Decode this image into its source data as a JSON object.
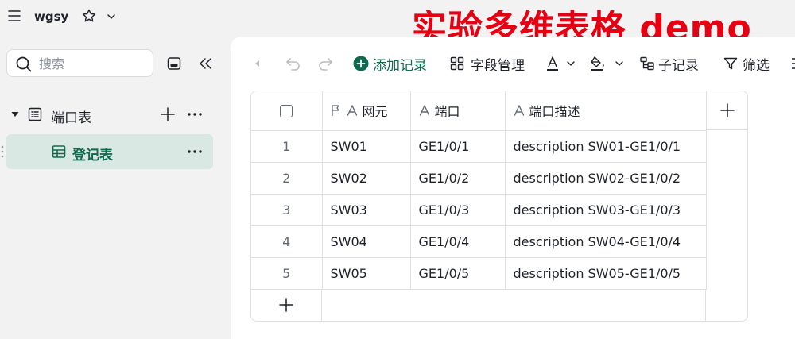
{
  "header": {
    "title": "wgsy",
    "banner": "实验多维表格 demo"
  },
  "sidebar": {
    "search": {
      "placeholder": "搜索",
      "value": ""
    },
    "items": [
      {
        "label": "端口表",
        "expanded": true
      },
      {
        "label": "登记表",
        "selected": true
      }
    ]
  },
  "toolbar": {
    "add_record": "添加记录",
    "field_manage": "字段管理",
    "sub_record": "子记录",
    "filter": "筛选"
  },
  "table": {
    "columns": [
      "网元",
      "端口",
      "端口描述"
    ],
    "rows": [
      {
        "num": "1",
        "ne": "SW01",
        "port": "GE1/0/1",
        "desc": "description SW01-GE1/0/1"
      },
      {
        "num": "2",
        "ne": "SW02",
        "port": "GE1/0/2",
        "desc": "description SW02-GE1/0/2"
      },
      {
        "num": "3",
        "ne": "SW03",
        "port": "GE1/0/3",
        "desc": "description SW03-GE1/0/3"
      },
      {
        "num": "4",
        "ne": "SW04",
        "port": "GE1/0/4",
        "desc": "description SW04-GE1/0/4"
      },
      {
        "num": "5",
        "ne": "SW05",
        "port": "GE1/0/5",
        "desc": "description SW05-GE1/0/5"
      }
    ]
  },
  "colors": {
    "accent": "#0f6b4f",
    "selected_bg": "#d9e8e2",
    "banner": "#e60012"
  },
  "icons": {
    "menu": "menu-icon",
    "star": "star-icon",
    "search": "search-icon",
    "collapse": "collapse-sidebar-icon",
    "add": "plus-icon",
    "more": "more-icon",
    "table": "table-grid-icon"
  }
}
